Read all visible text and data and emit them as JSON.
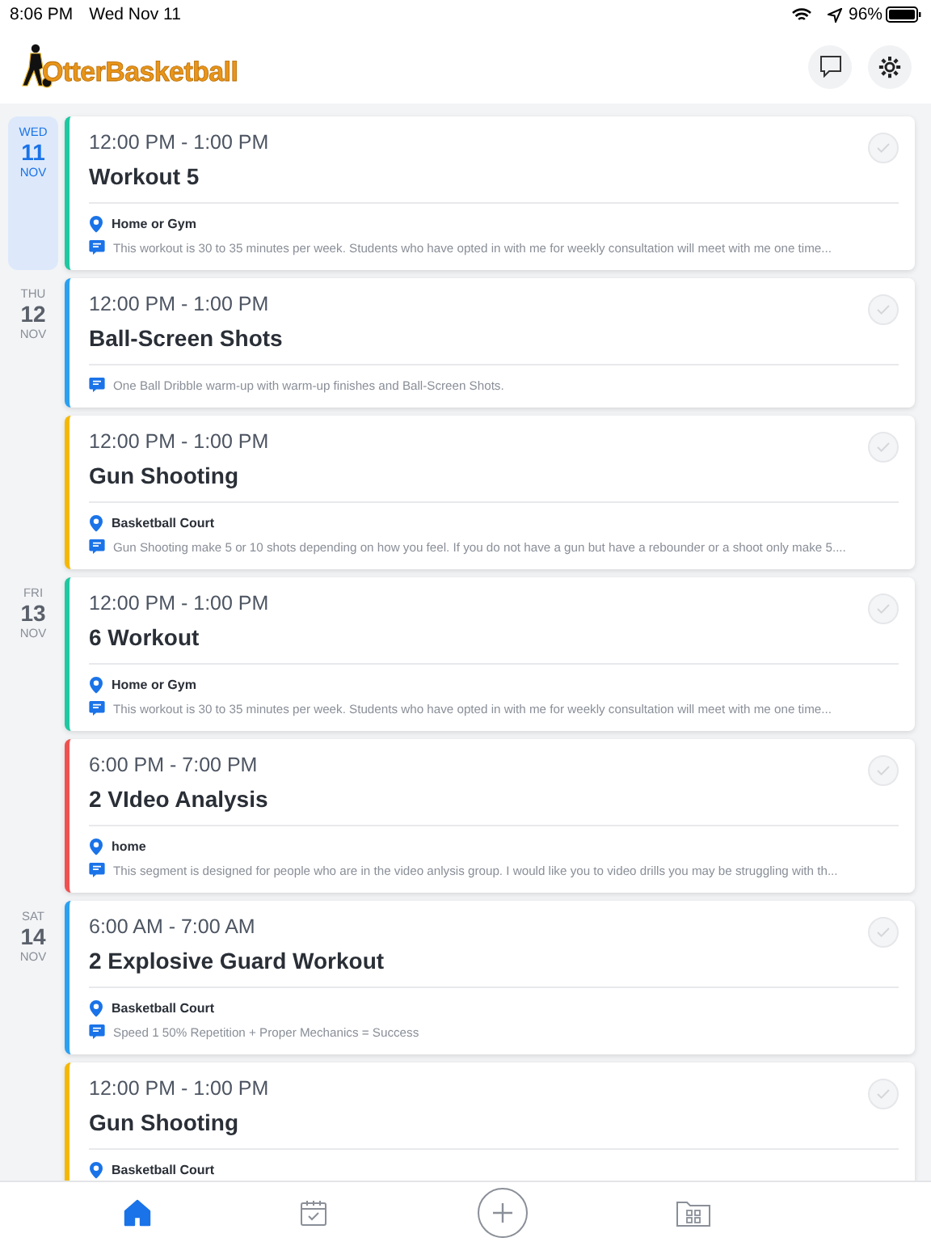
{
  "status_bar": {
    "time": "8:06 PM",
    "date": "Wed Nov 11",
    "battery": "96%"
  },
  "header": {
    "logo": "OtterBasketball"
  },
  "days": [
    {
      "weekday": "WED",
      "day": "11",
      "month": "NOV",
      "selected": true,
      "events": [
        {
          "time": "12:00 PM - 1:00 PM",
          "title": "Workout 5",
          "color": "#1ec8a0",
          "done": false,
          "location": "Home or Gym",
          "description": "This workout is 30 to 35 minutes per week.  Students who have opted in with me for weekly consultation will meet with me one time..."
        }
      ]
    },
    {
      "weekday": "THU",
      "day": "12",
      "month": "NOV",
      "selected": false,
      "events": [
        {
          "time": "12:00 PM - 1:00 PM",
          "title": "Ball-Screen Shots",
          "color": "#2aa0f0",
          "done": false,
          "description": "One Ball Dribble warm-up with warm-up finishes and Ball-Screen Shots."
        },
        {
          "time": "12:00 PM - 1:00 PM",
          "title": "Gun Shooting",
          "color": "#f5b800",
          "done": false,
          "location": "Basketball Court",
          "description": "Gun Shooting make 5 or 10 shots depending on how you feel.  If you do not have a gun but have a rebounder or a shoot only make 5...."
        }
      ]
    },
    {
      "weekday": "FRI",
      "day": "13",
      "month": "NOV",
      "selected": false,
      "events": [
        {
          "time": "12:00 PM - 1:00 PM",
          "title": "6 Workout",
          "color": "#1ec8a0",
          "done": false,
          "location": "Home or Gym",
          "description": "This workout is 30 to 35 minutes per week.  Students who have opted in with me for weekly consultation will meet with me one time..."
        },
        {
          "time": "6:00 PM - 7:00 PM",
          "title": "2 VIdeo Analysis",
          "color": "#f05050",
          "done": false,
          "location": "home",
          "description": "This segment is designed for people who are in the video anlysis group.  I would like you to video drills you may be struggling with th..."
        }
      ]
    },
    {
      "weekday": "SAT",
      "day": "14",
      "month": "NOV",
      "selected": false,
      "events": [
        {
          "time": "6:00 AM - 7:00 AM",
          "title": "2 Explosive Guard Workout",
          "color": "#2aa0f0",
          "done": false,
          "location": "Basketball Court",
          "description": "Speed 1 50%  Repetition + Proper Mechanics =  Success"
        },
        {
          "time": "12:00 PM - 1:00 PM",
          "title": "Gun Shooting",
          "color": "#f5b800",
          "done": false,
          "location": "Basketball Court"
        }
      ]
    }
  ],
  "tabs": [
    {
      "kind": "home",
      "selected": true
    },
    {
      "kind": "calendar",
      "selected": false
    },
    {
      "kind": "add",
      "selected": false
    },
    {
      "kind": "folder",
      "selected": false
    }
  ]
}
